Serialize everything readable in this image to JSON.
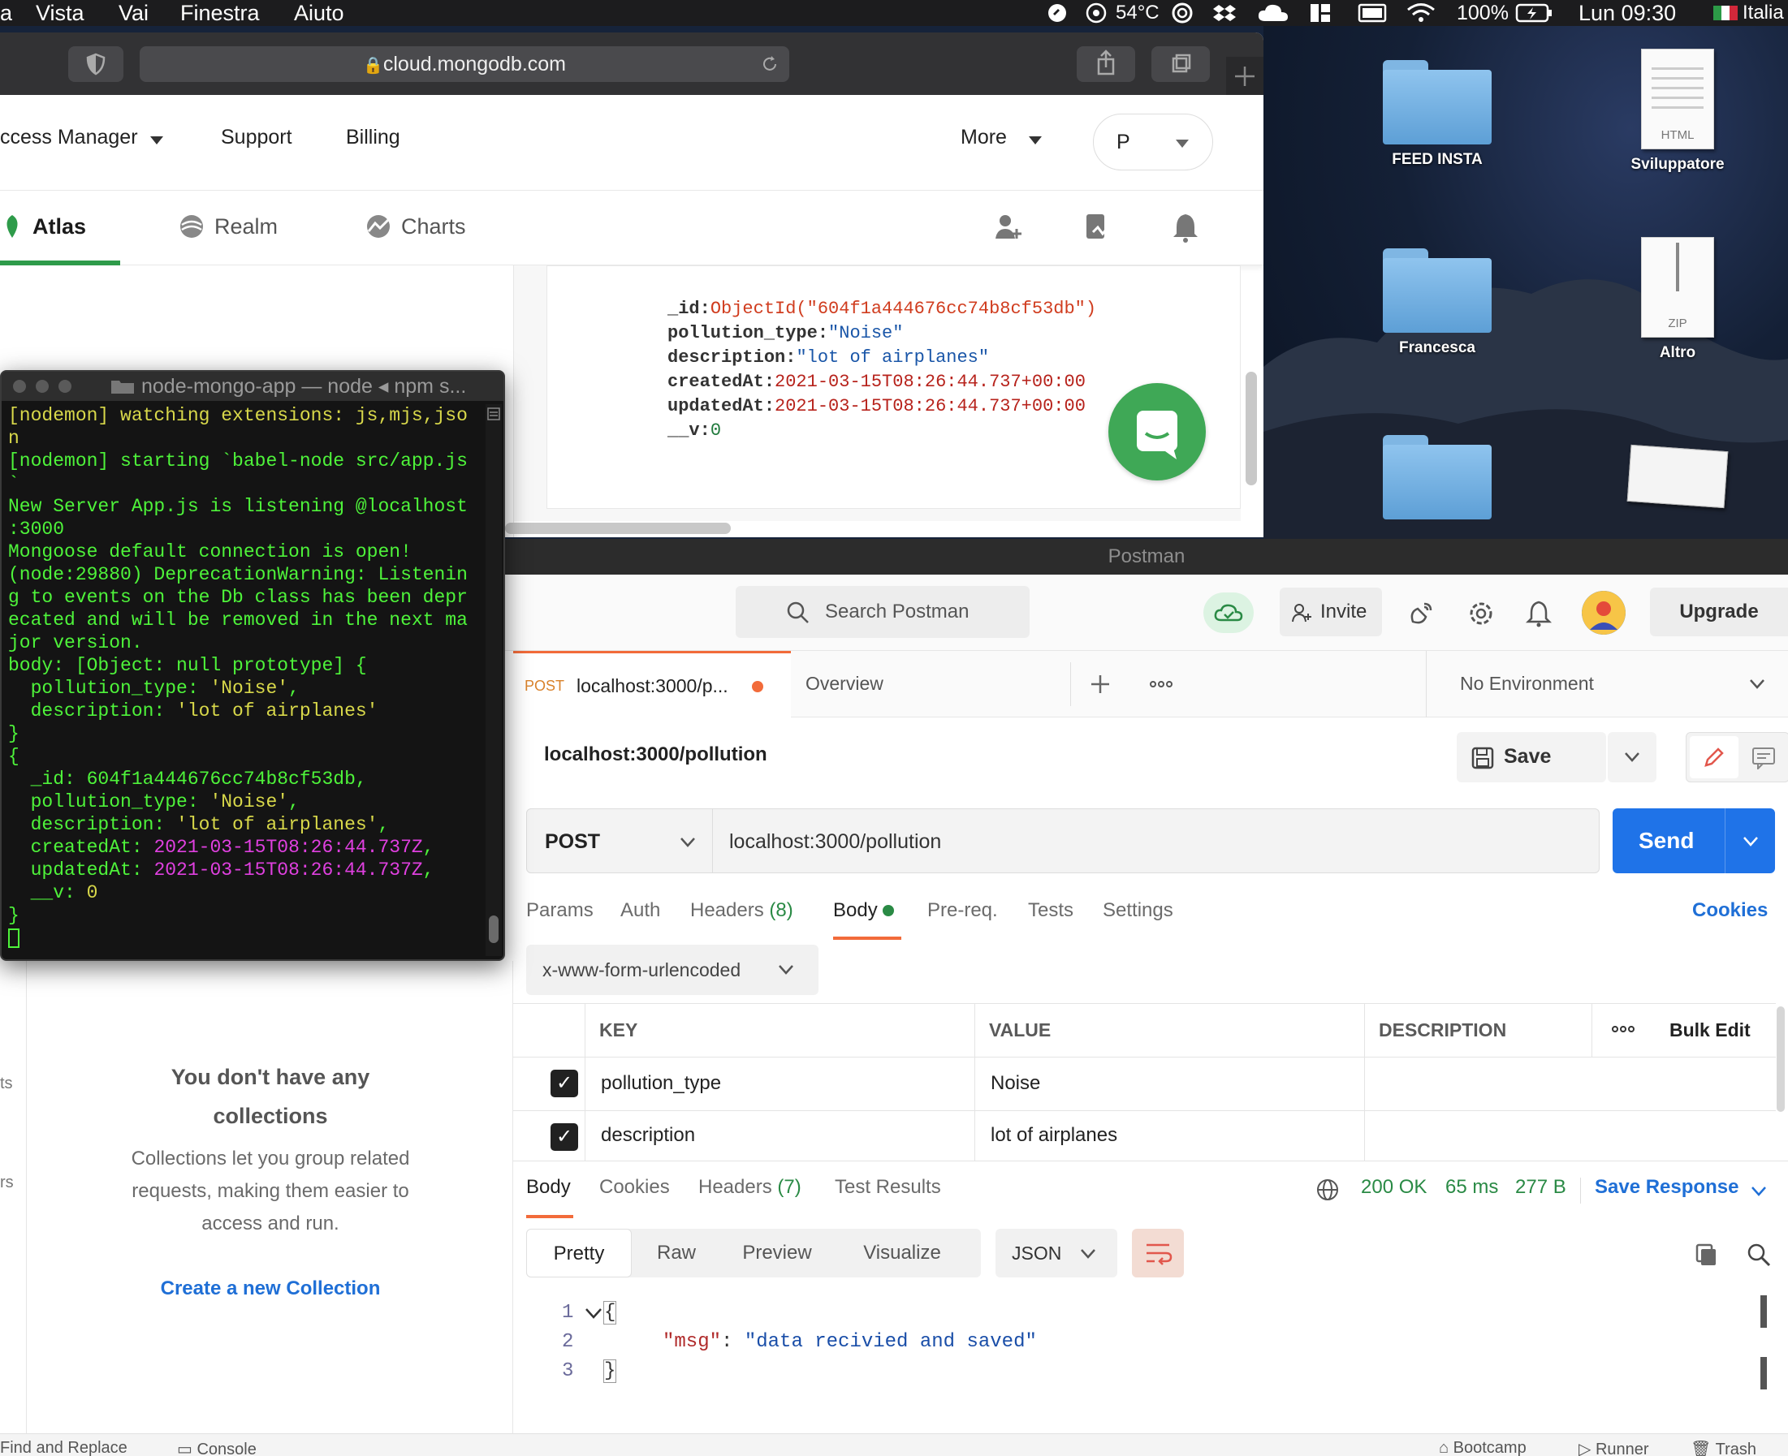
{
  "menubar": {
    "items": [
      "Vista",
      "Vai",
      "Finestra",
      "Aiuto"
    ],
    "temp": "54°C",
    "battery": "100%",
    "clock": "Lun 09:30",
    "lang": "Italia"
  },
  "desktop": {
    "items": [
      {
        "label": "FEED INSTA",
        "kind": "folder"
      },
      {
        "label": "Sviluppatore",
        "kind": "doc",
        "ext": "HTML"
      },
      {
        "label": "Francesca",
        "kind": "folder"
      },
      {
        "label": "Altro",
        "kind": "doc",
        "ext": "ZIP"
      }
    ]
  },
  "safari": {
    "url": "cloud.mongodb.com"
  },
  "mongodb": {
    "nav": {
      "access": "ccess Manager",
      "support": "Support",
      "billing": "Billing",
      "more": "More",
      "org": "P"
    },
    "tabs": {
      "atlas": "Atlas",
      "realm": "Realm",
      "charts": "Charts"
    },
    "document": {
      "id_key": "_id:",
      "id_val": "ObjectId(\"604f1a444676cc74b8cf53db\")",
      "type_key": "pollution_type:",
      "type_val": "\"Noise\"",
      "desc_key": "description:",
      "desc_val": "\"lot of airplanes\"",
      "created_key": "createdAt:",
      "created_val": "2021-03-15T08:26:44.737+00:00",
      "updated_key": "updatedAt:",
      "updated_val": "2021-03-15T08:26:44.737+00:00",
      "v_key": "__v:",
      "v_val": "0"
    }
  },
  "terminal": {
    "title": "node-mongo-app — node ◂ npm s...",
    "lines": [
      {
        "t": "[nodemon] watching extensions: js,mjs,jso",
        "c": "ty"
      },
      {
        "t": "n",
        "c": "ty"
      },
      {
        "t": "[nodemon] starting `babel-node src/app.js",
        "c": "tg"
      },
      {
        "t": "`",
        "c": "tg"
      },
      {
        "t": "New Server App.js is listening @localhost",
        "c": "tg"
      },
      {
        "t": ":3000",
        "c": "tg"
      },
      {
        "t": "Mongoose default connection is open!",
        "c": "tg"
      },
      {
        "t": "(node:29880) DeprecationWarning: Listenin",
        "c": "tg"
      },
      {
        "t": "g to events on the Db class has been depr",
        "c": "tg"
      },
      {
        "t": "ecated and will be removed in the next ma",
        "c": "tg"
      },
      {
        "t": "jor version.",
        "c": "tg"
      },
      {
        "t": "body: [Object: null prototype] {",
        "c": "tg"
      },
      {
        "t": "  pollution_type: 'Noise',",
        "c": "tg"
      },
      {
        "t": "  description: 'lot of airplanes'",
        "c": "tg"
      },
      {
        "t": "}",
        "c": "tg"
      },
      {
        "t": "{",
        "c": "tg"
      },
      {
        "t": "  _id: 604f1a444676cc74b8cf53db,",
        "c": "tg"
      },
      {
        "t": "  pollution_type: 'Noise',",
        "c": "tg"
      },
      {
        "t": "  description: 'lot of airplanes',",
        "c": "tg"
      },
      {
        "t": "  createdAt: 2021-03-15T08:26:44.737Z,",
        "c": "tg"
      },
      {
        "t": "  updatedAt: 2021-03-15T08:26:44.737Z,",
        "c": "tg"
      },
      {
        "t": "  __v: 0",
        "c": "tg"
      },
      {
        "t": "}",
        "c": "tg"
      }
    ]
  },
  "postman": {
    "title": "Postman",
    "search_placeholder": "Search Postman",
    "invite": "Invite",
    "upgrade": "Upgrade",
    "tab_method": "POST",
    "tab_label": "localhost:3000/p...",
    "overview": "Overview",
    "environment": "No Environment",
    "request_name": "localhost:3000/pollution",
    "save": "Save",
    "method": "POST",
    "url": "localhost:3000/pollution",
    "send": "Send",
    "subtabs": {
      "params": "Params",
      "auth": "Auth",
      "headers": "Headers",
      "headers_count": "(8)",
      "body": "Body",
      "prereq": "Pre-req.",
      "tests": "Tests",
      "settings": "Settings",
      "cookies": "Cookies"
    },
    "body_type": "x-www-form-urlencoded",
    "table": {
      "headers": [
        "KEY",
        "VALUE",
        "DESCRIPTION"
      ],
      "bulk_edit": "Bulk Edit",
      "rows": [
        {
          "key": "pollution_type",
          "value": "Noise",
          "description": ""
        },
        {
          "key": "description",
          "value": "lot of airplanes",
          "description": ""
        }
      ]
    },
    "response": {
      "tabs": {
        "body": "Body",
        "cookies": "Cookies",
        "headers": "Headers",
        "headers_count": "(7)",
        "tests": "Test Results"
      },
      "status": "200 OK",
      "time": "65 ms",
      "size": "277 B",
      "save_response": "Save Response",
      "views": [
        "Pretty",
        "Raw",
        "Preview",
        "Visualize"
      ],
      "format": "JSON",
      "code": {
        "l1": "1",
        "l2": "2",
        "l3": "3",
        "open": "{",
        "key": "\"msg\"",
        "colon": ": ",
        "val": "\"data recivied and saved\"",
        "close": "}"
      }
    },
    "sidebar": {
      "empty_title_1": "You don't have any",
      "empty_title_2": "collections",
      "empty_desc_1": "Collections let you group related",
      "empty_desc_2": "requests, making them easier to",
      "empty_desc_3": "access and run.",
      "create_link": "Create a new Collection",
      "edge_1": "ts",
      "edge_2": "rs"
    },
    "footer": {
      "find": "Find and Replace",
      "console": "Console",
      "bootcamp": "Bootcamp",
      "runner": "Runner",
      "trash": "Trash"
    }
  }
}
